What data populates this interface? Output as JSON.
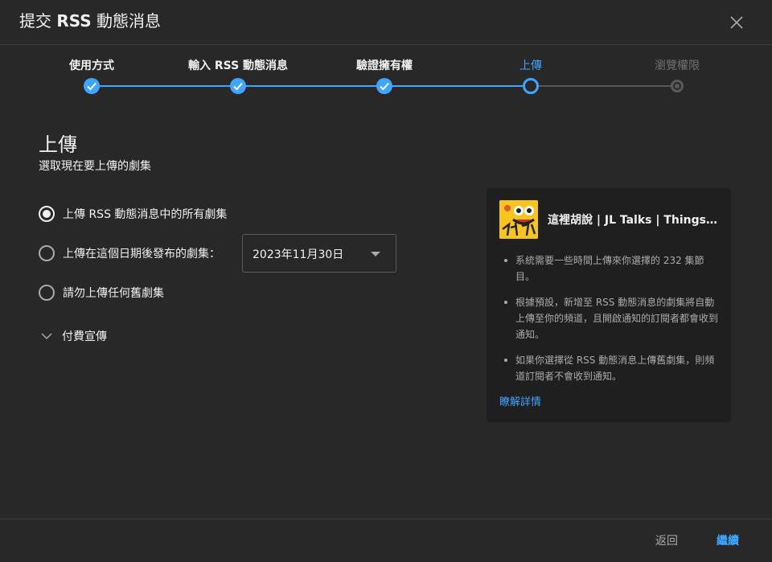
{
  "dialog": {
    "title_prefix": "提交",
    "title_bold": "RSS",
    "title_suffix": "動態消息"
  },
  "stepper": {
    "steps": [
      {
        "label": "使用方式",
        "state": "done"
      },
      {
        "label": "輸入 RSS 動態消息",
        "state": "done"
      },
      {
        "label": "驗證擁有權",
        "state": "done"
      },
      {
        "label": "上傳",
        "state": "current"
      },
      {
        "label": "瀏覽權限",
        "state": "pending"
      }
    ],
    "colors": {
      "active": "#3ea6ff",
      "inactive": "#5a5a5a"
    }
  },
  "upload": {
    "title": "上傳",
    "subtitle": "選取現在要上傳的劇集",
    "options": [
      {
        "label": "上傳 RSS 動態消息中的所有劇集",
        "checked": true
      },
      {
        "label": "上傳在這個日期後發布的劇集：",
        "checked": false
      },
      {
        "label": "請勿上傳任何舊劇集",
        "checked": false
      }
    ],
    "date_value": "2023年11月30日",
    "paid_promo_label": "付費宣傳"
  },
  "info_card": {
    "podcast_title": "這裡胡說 | JL Talks | Things in...",
    "bullets": [
      "系統需要一些時間上傳來你選擇的 232 集節目。",
      "根據預設，新增至 RSS 動態消息的劇集將自動上傳至你的頻道，且開啟通知的訂閱者都會收到通知。",
      "如果你選擇從 RSS 動態消息上傳舊劇集，則頻道訂閱者不會收到通知。"
    ],
    "learn_more": "瞭解詳情"
  },
  "footer": {
    "back_label": "返回",
    "next_label": "繼續"
  }
}
